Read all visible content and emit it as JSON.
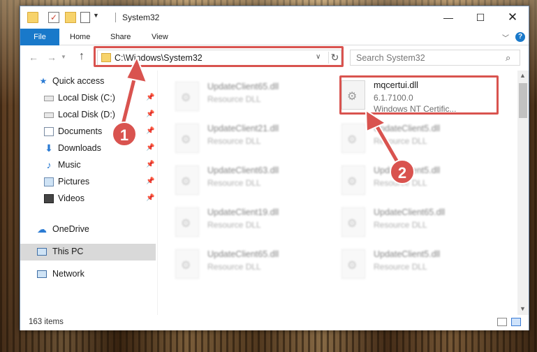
{
  "window": {
    "title": "System32"
  },
  "ribbon": {
    "tabs": [
      {
        "label": "File"
      },
      {
        "label": "Home"
      },
      {
        "label": "Share"
      },
      {
        "label": "View"
      }
    ],
    "help_label": "?"
  },
  "address_bar": {
    "path": "C:\\Windows\\System32"
  },
  "search": {
    "placeholder": "Search System32"
  },
  "sidebar": {
    "items": [
      {
        "label": "Quick access",
        "icon": "star-icon"
      },
      {
        "label": "Local Disk (C:)",
        "icon": "drive-icon",
        "pinned": true
      },
      {
        "label": "Local Disk (D:)",
        "icon": "drive-icon",
        "pinned": true
      },
      {
        "label": "Documents",
        "icon": "documents-icon",
        "pinned": true
      },
      {
        "label": "Downloads",
        "icon": "download-icon",
        "pinned": true
      },
      {
        "label": "Music",
        "icon": "music-icon",
        "pinned": true
      },
      {
        "label": "Pictures",
        "icon": "pictures-icon",
        "pinned": true
      },
      {
        "label": "Videos",
        "icon": "videos-icon",
        "pinned": true
      },
      {
        "label": "OneDrive",
        "icon": "cloud-icon"
      },
      {
        "label": "This PC",
        "icon": "computer-icon",
        "selected": true
      },
      {
        "label": "Network",
        "icon": "network-icon"
      }
    ]
  },
  "files": {
    "left_column": [
      {
        "name": "UpdateClient65.dll",
        "type": "Resource DLL"
      },
      {
        "name": "UpdateClient21.dll",
        "type": "Resource DLL"
      },
      {
        "name": "UpdateClient63.dll",
        "type": "Resource DLL"
      },
      {
        "name": "UpdateClient19.dll",
        "type": "Resource DLL"
      },
      {
        "name": "UpdateClient65.dll",
        "type": "Resource DLL"
      }
    ],
    "highlighted": {
      "name": "mqcertui.dll",
      "version": "6.1.7100.0",
      "description": "Windows NT Certific..."
    },
    "right_column": [
      {
        "name": "UpdateClient5.dll",
        "type": "Resource DLL"
      },
      {
        "name": "UpdateClient5.dll",
        "type": "Resource DLL"
      },
      {
        "name": "UpdateClient65.dll",
        "type": "Resource DLL"
      },
      {
        "name": "UpdateClient5.dll",
        "type": "Resource DLL"
      }
    ]
  },
  "status": {
    "item_count": "163 items"
  },
  "callouts": {
    "one": "1",
    "two": "2",
    "color": "#d9534f"
  },
  "colors": {
    "accent": "#1979ca",
    "highlight": "#d9534f"
  }
}
